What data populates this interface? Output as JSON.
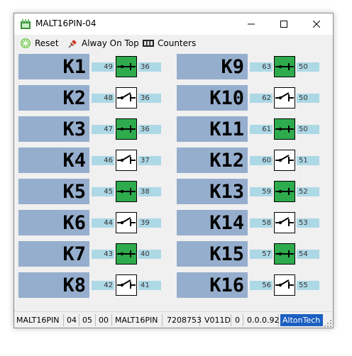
{
  "window": {
    "title": "MALT16PIN-04"
  },
  "menu": [
    {
      "label": "Reset",
      "icon": "reset-icon"
    },
    {
      "label": "Alway On Top",
      "icon": "pin-icon"
    },
    {
      "label": "Counters",
      "icon": "counter-icon"
    }
  ],
  "relays": [
    {
      "label": "K1",
      "left": "49",
      "right": "36",
      "state": "closed"
    },
    {
      "label": "K2",
      "left": "48",
      "right": "36",
      "state": "open"
    },
    {
      "label": "K3",
      "left": "47",
      "right": "36",
      "state": "closed"
    },
    {
      "label": "K4",
      "left": "46",
      "right": "37",
      "state": "open"
    },
    {
      "label": "K5",
      "left": "45",
      "right": "38",
      "state": "closed"
    },
    {
      "label": "K6",
      "left": "44",
      "right": "39",
      "state": "open"
    },
    {
      "label": "K7",
      "left": "43",
      "right": "40",
      "state": "closed"
    },
    {
      "label": "K8",
      "left": "42",
      "right": "41",
      "state": "open"
    },
    {
      "label": "K9",
      "left": "63",
      "right": "50",
      "state": "closed"
    },
    {
      "label": "K10",
      "left": "62",
      "right": "50",
      "state": "open"
    },
    {
      "label": "K11",
      "left": "61",
      "right": "50",
      "state": "closed"
    },
    {
      "label": "K12",
      "left": "60",
      "right": "51",
      "state": "open"
    },
    {
      "label": "K13",
      "left": "59",
      "right": "52",
      "state": "closed"
    },
    {
      "label": "K14",
      "left": "58",
      "right": "53",
      "state": "open"
    },
    {
      "label": "K15",
      "left": "57",
      "right": "54",
      "state": "closed"
    },
    {
      "label": "K16",
      "left": "56",
      "right": "55",
      "state": "open"
    }
  ],
  "status": [
    "MALT16PIN",
    "04",
    "05",
    "00",
    "MALT16PIN",
    "7208753",
    "V011D",
    "0",
    "0.0.0.92",
    "AltonTech"
  ],
  "colors": {
    "relay_label_bg": "#96aecd",
    "counter_bg": "#add8e6",
    "switch_on": "#2eab4d",
    "brand": "#1b5fc1"
  }
}
